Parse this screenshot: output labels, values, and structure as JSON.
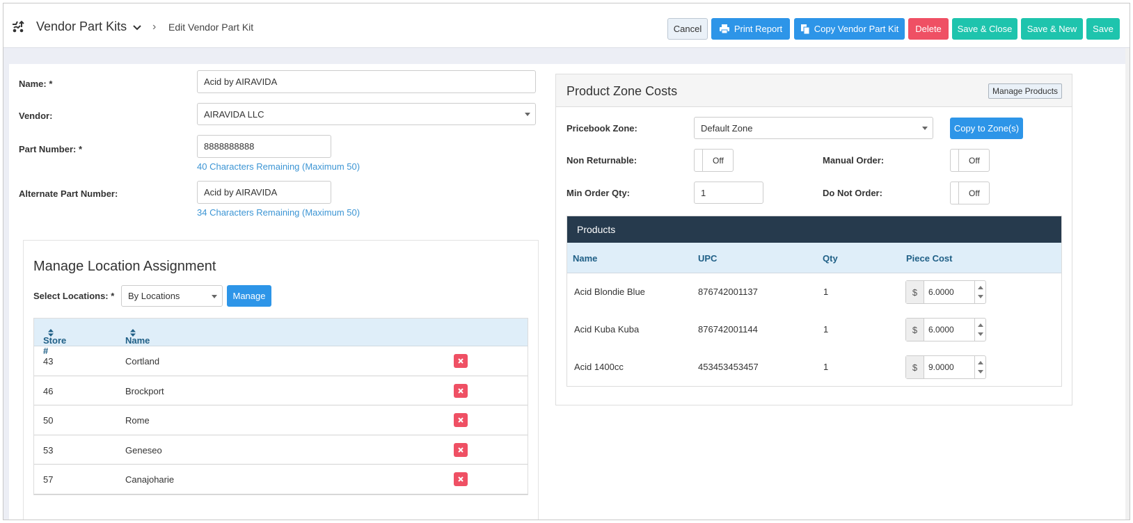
{
  "header": {
    "app_title": "Vendor Part Kits",
    "breadcrumb": "Edit Vendor Part Kit",
    "buttons": {
      "cancel": "Cancel",
      "print": "Print Report",
      "copy": "Copy Vendor Part Kit",
      "delete": "Delete",
      "save_close": "Save & Close",
      "save_new": "Save & New",
      "save": "Save"
    }
  },
  "form": {
    "name_label": "Name: *",
    "name_value": "Acid by AIRAVIDA",
    "vendor_label": "Vendor:",
    "vendor_value": "AIRAVIDA LLC",
    "part_number_label": "Part Number: *",
    "part_number_value": "8888888888",
    "part_number_hint": "40 Characters Remaining (Maximum 50)",
    "alt_part_label": "Alternate Part Number:",
    "alt_part_value": "Acid by AIRAVIDA",
    "alt_part_hint": "34 Characters Remaining (Maximum 50)"
  },
  "locations": {
    "title": "Manage Location Assignment",
    "select_label": "Select Locations: *",
    "select_value": "By Locations",
    "manage_button": "Manage",
    "columns": {
      "store": "Store #",
      "name": "Name"
    },
    "rows": [
      {
        "store": "43",
        "name": "Cortland"
      },
      {
        "store": "46",
        "name": "Brockport"
      },
      {
        "store": "50",
        "name": "Rome"
      },
      {
        "store": "53",
        "name": "Geneseo"
      },
      {
        "store": "57",
        "name": "Canajoharie"
      }
    ]
  },
  "zone": {
    "title": "Product Zone Costs",
    "manage_products": "Manage Products",
    "pricebook_label": "Pricebook Zone:",
    "pricebook_value": "Default Zone",
    "copy_button": "Copy to Zone(s)",
    "non_returnable_label": "Non Returnable:",
    "non_returnable_value": "Off",
    "manual_order_label": "Manual Order:",
    "manual_order_value": "Off",
    "min_order_label": "Min Order Qty:",
    "min_order_value": "1",
    "do_not_order_label": "Do Not Order:",
    "do_not_order_value": "Off"
  },
  "products": {
    "banner": "Products",
    "columns": {
      "name": "Name",
      "upc": "UPC",
      "qty": "Qty",
      "cost": "Piece Cost"
    },
    "currency": "$",
    "rows": [
      {
        "name": "Acid Blondie Blue",
        "upc": "876742001137",
        "qty": "1",
        "cost": "6.0000"
      },
      {
        "name": "Acid Kuba Kuba",
        "upc": "876742001144",
        "qty": "1",
        "cost": "6.0000"
      },
      {
        "name": "Acid 1400cc",
        "upc": "453453453457",
        "qty": "1",
        "cost": "9.0000"
      }
    ]
  },
  "colors": {
    "primary": "#2d95e8",
    "success": "#1ec4ad",
    "danger": "#ef5064",
    "table_header": "#dfeef9",
    "dark_banner": "#263a4d"
  }
}
